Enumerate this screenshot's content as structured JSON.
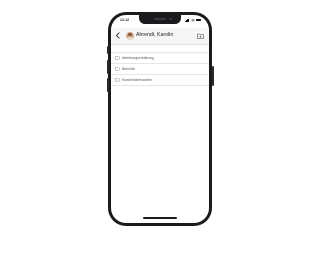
{
  "status_bar": {
    "time": "12:12"
  },
  "header": {
    "title": "Ahrendt, Karolin",
    "back_icon": "chevron-left-icon",
    "action_icon": "folder-add-icon",
    "avatar_icon": "user-avatar"
  },
  "folders": [
    {
      "label": "Abtretungserklärung",
      "icon": "folder-icon"
    },
    {
      "label": "Berichte",
      "icon": "folder-icon"
    },
    {
      "label": "Kundenübersichten",
      "icon": "folder-icon"
    }
  ],
  "colors": {
    "nav_background": "#f6f6f7",
    "phone_frame": "#1b1b1d",
    "text_primary": "#222222",
    "text_secondary": "#555555"
  }
}
